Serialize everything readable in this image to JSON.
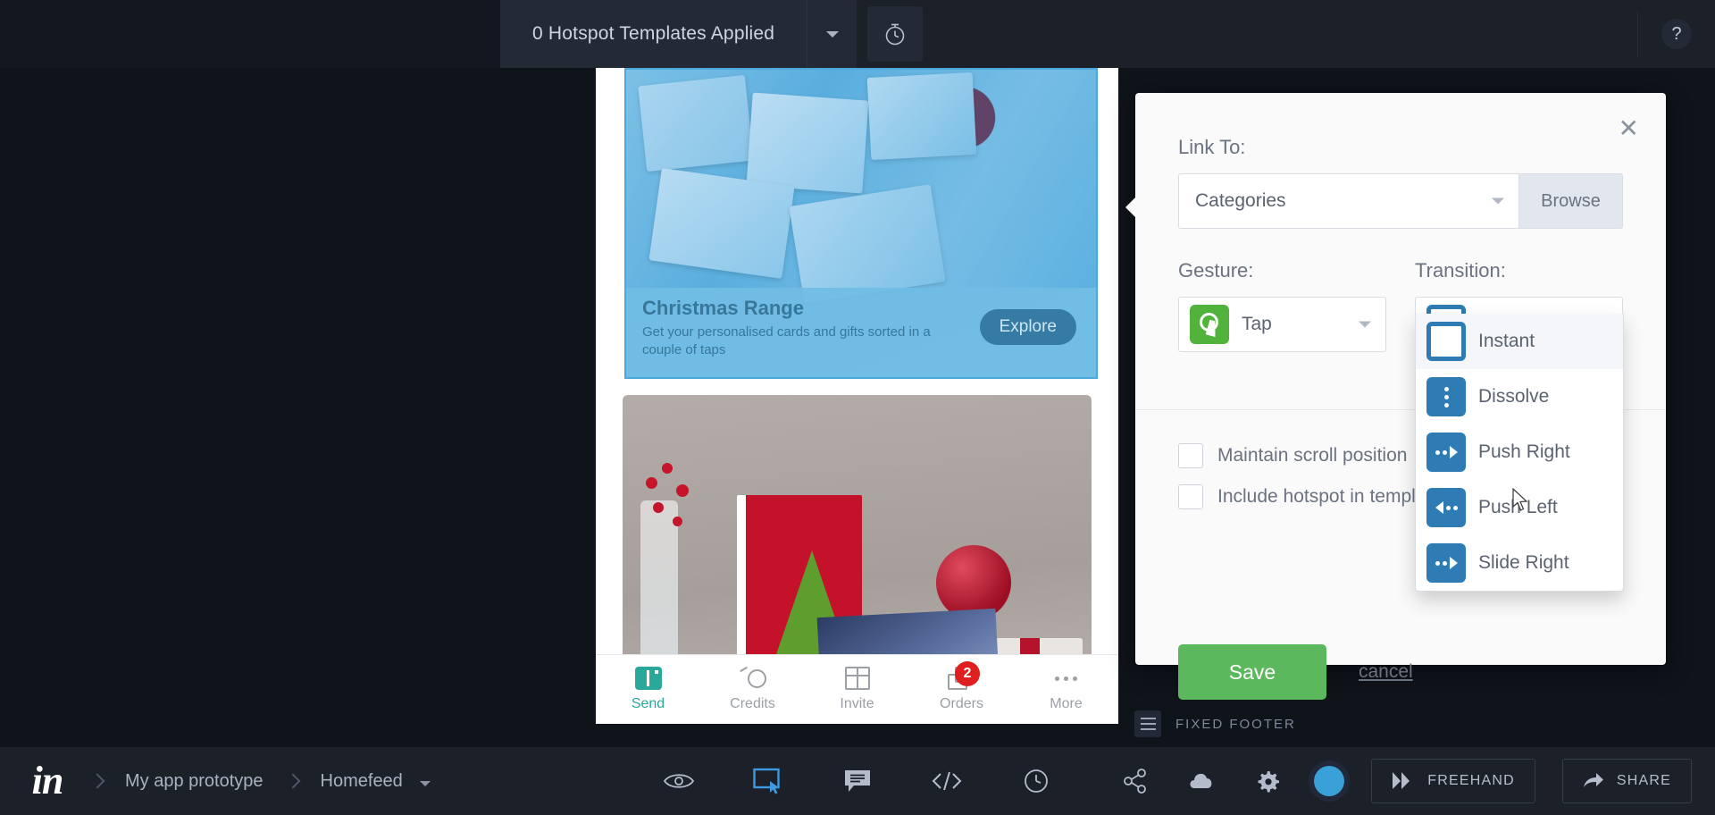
{
  "topbar": {
    "hotspot_templates_label": "0 Hotspot Templates Applied",
    "caret_icon": "chevron-down-icon",
    "timer_icon": "stopwatch-icon",
    "help_label": "?"
  },
  "phone_screen": {
    "promo_card": {
      "title": "Christmas Range",
      "subtitle": "Get your personalised cards and gifts sorted in a couple of taps",
      "button_label": "Explore"
    },
    "nav": [
      {
        "label": "Send",
        "icon": "send-icon",
        "active": true,
        "badge": ""
      },
      {
        "label": "Credits",
        "icon": "credits-icon",
        "active": false,
        "badge": ""
      },
      {
        "label": "Invite",
        "icon": "gift-icon",
        "active": false,
        "badge": ""
      },
      {
        "label": "Orders",
        "icon": "orders-icon",
        "active": false,
        "badge": "2"
      },
      {
        "label": "More",
        "icon": "ellipsis-icon",
        "active": false,
        "badge": ""
      }
    ]
  },
  "fixed_footer": {
    "icon": "hamburger-icon",
    "label": "FIXED FOOTER"
  },
  "modal": {
    "close_icon": "close-icon",
    "link_to_label": "Link To:",
    "link_to_value": "Categories",
    "browse_label": "Browse",
    "gesture_label": "Gesture:",
    "gesture_value": "Tap",
    "gesture_icon": "tap-icon",
    "transition_label": "Transition:",
    "transition_value": "Instant",
    "transition_icon": "instant-icon",
    "transition_options": [
      {
        "label": "Instant",
        "icon": "instant-icon",
        "style": "instant",
        "hovered": false
      },
      {
        "label": "Dissolve",
        "icon": "dissolve-icon",
        "style": "dots",
        "hovered": false
      },
      {
        "label": "Push Right",
        "icon": "push-right-icon",
        "style": "right",
        "hovered": true
      },
      {
        "label": "Push Left",
        "icon": "push-left-icon",
        "style": "left",
        "hovered": false
      },
      {
        "label": "Slide Right",
        "icon": "slide-right-icon",
        "style": "right",
        "hovered": false
      }
    ],
    "checkboxes": [
      {
        "label": "Maintain scroll position",
        "checked": false
      },
      {
        "label": "Include hotspot in template",
        "checked": false
      }
    ],
    "save_label": "Save",
    "cancel_label": "cancel"
  },
  "bottombar": {
    "logo": "invision-logo",
    "breadcrumbs": [
      {
        "label": "My app prototype",
        "has_caret": false
      },
      {
        "label": "Homefeed",
        "has_caret": true
      }
    ],
    "tools": [
      {
        "name": "preview-eye-icon",
        "active": false
      },
      {
        "name": "hotspot-build-icon",
        "active": true
      },
      {
        "name": "comment-icon",
        "active": false
      },
      {
        "name": "code-inspect-icon",
        "active": false
      },
      {
        "name": "history-clock-icon",
        "active": false
      }
    ],
    "right_icons": [
      {
        "name": "share-nodes-icon"
      },
      {
        "name": "cloud-upload-icon"
      },
      {
        "name": "gear-icon"
      }
    ],
    "avatar": "user-avatar",
    "freehand_label": "FREEHAND",
    "share_label": "SHARE"
  },
  "colors": {
    "chrome_dark": "#1b2029",
    "stage_dark": "#0f131a",
    "accent_blue": "#2e7cb3",
    "hotspot_blue": "#4aa8da",
    "save_green": "#5cb85c",
    "gesture_green": "#52b33c",
    "badge_red": "#e02020",
    "nav_teal": "#2aa89a"
  }
}
